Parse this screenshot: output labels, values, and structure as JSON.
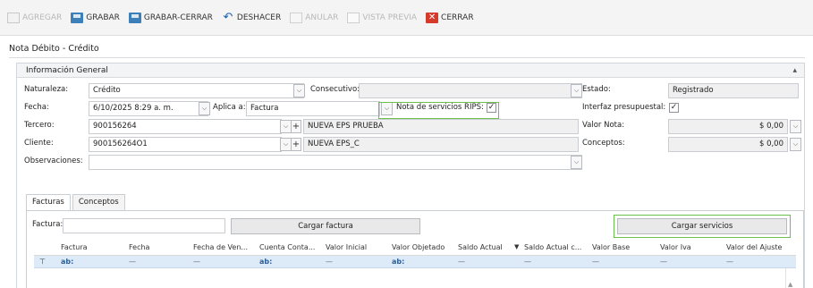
{
  "toolbar": {
    "agregar": "AGREGAR",
    "grabar": "GRABAR",
    "grabar_cerrar": "GRABAR-CERRAR",
    "deshacer": "DESHACER",
    "anular": "ANULAR",
    "vista_previa": "VISTA PREVIA",
    "cerrar": "CERRAR"
  },
  "document": {
    "title": "Nota Débito - Crédito"
  },
  "section": {
    "title": "Información General",
    "collapse": "▴"
  },
  "form": {
    "naturaleza": {
      "label": "Naturaleza:",
      "value": "Crédito"
    },
    "consecutivo": {
      "label": "Consecutivo:",
      "value": ""
    },
    "estado": {
      "label": "Estado:",
      "value": "Registrado"
    },
    "fecha": {
      "label": "Fecha:",
      "value": "6/10/2025 8:29 a. m."
    },
    "aplica": {
      "label": "Aplica a:",
      "value": "Factura"
    },
    "rips": {
      "label": "Nota de servicios RIPS:",
      "checked": "✓"
    },
    "interfaz": {
      "label": "Interfaz presupuestal:",
      "checked": "✓"
    },
    "tercero": {
      "label": "Tercero:",
      "code": "900156264",
      "name": "NUEVA EPS  PRUEBA"
    },
    "valor_nota": {
      "label": "Valor Nota:",
      "value": "$ 0,00"
    },
    "cliente": {
      "label": "Cliente:",
      "code": "900156264O1",
      "name": "NUEVA EPS_C"
    },
    "conceptos": {
      "label": "Conceptos:",
      "value": "$ 0,00"
    },
    "observaciones": {
      "label": "Observaciones:",
      "value": ""
    }
  },
  "tabs": [
    {
      "label": "Facturas"
    },
    {
      "label": "Conceptos"
    }
  ],
  "facturas": {
    "factura_label": "Factura:",
    "factura_value": "",
    "cargar_factura": "Cargar factura",
    "cargar_servicios": "Cargar servicios",
    "columns": [
      "Factura",
      "Fecha",
      "Fecha de Ven...",
      "Cuenta Conta...",
      "Valor Inicial",
      "Valor Objetado",
      "Saldo Actual",
      "Saldo Actual c...",
      "Valor Base",
      "Valor Iva",
      "Valor del Ajuste"
    ],
    "sort_icon": "▼",
    "filter_row": {
      "marker": "⊤",
      "cells": [
        "ab:",
        "—",
        "—",
        "ab:",
        "—",
        "ab:",
        "—",
        "—",
        "—",
        "—",
        "—"
      ]
    }
  },
  "glyphs": {
    "dropdown": "⌵",
    "plus": "+"
  }
}
